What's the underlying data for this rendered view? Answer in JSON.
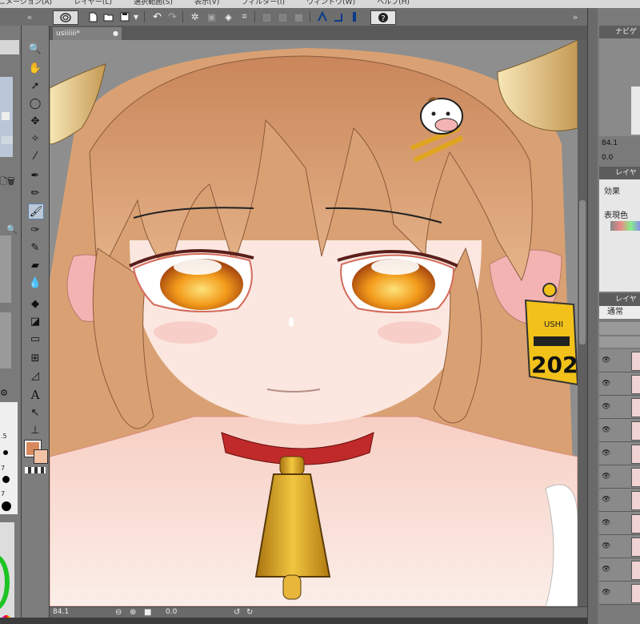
{
  "menu": {
    "items": [
      "ニメーション(A)",
      "レイヤー(L)",
      "選択範囲(S)",
      "表示(V)",
      "フィルター(I)",
      "ウィンドウ(W)",
      "ヘルプ(H)"
    ]
  },
  "document": {
    "tab_label": "usiiiiii*",
    "zoom": "84.1",
    "rotation": "0.0"
  },
  "navigator": {
    "title": "ナビゲ",
    "zoom": "84.1",
    "rotation": "0.0"
  },
  "layer_property": {
    "title": "レイヤ",
    "effect_label": "効果",
    "color_label": "表現色"
  },
  "layer_panel": {
    "title": "レイヤ",
    "blend_mode": "通常"
  },
  "left_panel": {
    "brush_sizes": [
      ".5",
      "7",
      "7"
    ]
  },
  "canvas_art": {
    "ear_tag_text": "USHI",
    "ear_tag_number": "202"
  },
  "colors": {
    "main_color": "#d9895e",
    "sub_color": "#f3c3a6",
    "hair": "#d9a173",
    "skin": "#fbe7e0",
    "eye": "#f29a1a",
    "bell": "#d9a420",
    "collar": "#c02a2a"
  }
}
